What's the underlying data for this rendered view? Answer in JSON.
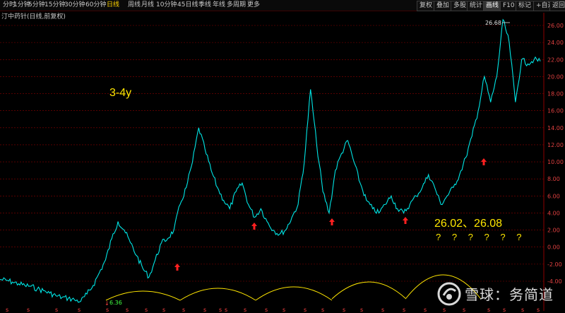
{
  "toolbar": {
    "periods": [
      "分时",
      "1分钟",
      "5分钟",
      "15分钟",
      "30分钟",
      "60分钟",
      "日线",
      "周线",
      "月线",
      "10分钟",
      "45日线",
      "季线",
      "年线",
      "多周期",
      "更多"
    ],
    "active_period": "日线",
    "right_buttons": [
      "复权",
      "叠加",
      "多股",
      "统计",
      "画线",
      "F10",
      "标记",
      "+自选",
      "返回"
    ],
    "active_right": "画线"
  },
  "title": "汀中药针(日线,前复权)",
  "annotations": {
    "period_note": "3-4y",
    "target_price": "26.02、26.08",
    "question_marks": "? ? ? ? ? ?"
  },
  "price_labels": {
    "high": "26.68",
    "low": "6.36"
  },
  "watermark": {
    "brand": "雪球：务简道"
  },
  "colors": {
    "background": "#000000",
    "grid": "#8b0000",
    "axis_text": "#e04040",
    "price_line": "#00e5e5",
    "annotation": "#ffe600",
    "arc": "#ffe600",
    "arrow": "#ff2020",
    "active_tab": "#ffd400"
  },
  "chart_data": {
    "type": "line",
    "title": "",
    "xlabel": "",
    "ylabel": "",
    "ylim": [
      -4.0,
      26.0
    ],
    "yticks": [
      -4.0,
      -2.0,
      0.0,
      2.0,
      4.0,
      6.0,
      8.0,
      10.0,
      12.0,
      14.0,
      16.0,
      18.0,
      20.0,
      22.0,
      24.0,
      26.0
    ],
    "ytick_labels": [
      "-4.00",
      "-2.00",
      "0.00",
      "2.00",
      "4.00",
      "6.00",
      "8.00",
      "10.00",
      "12.00",
      "14.00",
      "16.00",
      "18.00",
      "20.00",
      "22.00",
      "24.00",
      "26.00"
    ],
    "series": [
      {
        "values": [
          -3.8,
          -3.9,
          -4.1,
          -4.3,
          -4.5,
          -4.6,
          -4.9,
          -5.1,
          -5.4,
          -5.7,
          -5.9,
          -6.0,
          -6.2,
          -6.36,
          -5.5,
          -4.5,
          -3.0,
          -1.5,
          1.0,
          3.0,
          2.0,
          0.5,
          -1.0,
          -2.5,
          -3.5,
          -1.5,
          0.5,
          1.0,
          2.0,
          5.0,
          7.0,
          10.0,
          14.0,
          11.5,
          9.0,
          7.0,
          5.5,
          4.5,
          6.5,
          7.5,
          5.0,
          3.5,
          4.5,
          3.0,
          2.0,
          1.5,
          2.0,
          3.5,
          5.0,
          10.0,
          18.5,
          12.0,
          6.5,
          4.0,
          9.0,
          11.0,
          12.5,
          10.0,
          7.5,
          5.5,
          4.5,
          4.0,
          5.0,
          6.0,
          4.5,
          4.0,
          5.0,
          6.0,
          7.0,
          8.5,
          7.0,
          5.0,
          6.0,
          7.0,
          8.5,
          10.5,
          13.0,
          16.0,
          20.0,
          17.0,
          20.0,
          26.68,
          24.0,
          17.0,
          22.0,
          21.5,
          22.0,
          21.8
        ]
      }
    ],
    "low_point": 6.36,
    "high_point": 26.68
  }
}
